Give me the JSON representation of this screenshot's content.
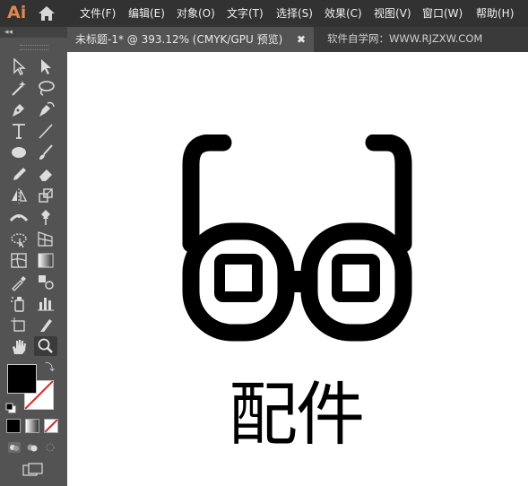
{
  "app": {
    "logo": "Ai"
  },
  "menu": [
    "文件(F)",
    "编辑(E)",
    "对象(O)",
    "文字(T)",
    "选择(S)",
    "效果(C)",
    "视图(V)",
    "窗口(W)",
    "帮助(H)"
  ],
  "document_tab": {
    "title": "未标题-1* @ 393.12% (CMYK/GPU 预览)",
    "close": "✖"
  },
  "watermark": "软件自学网：WWW.RJZXW.COM",
  "toolbar": {
    "collapse": "◂◂",
    "tools": [
      "selection-tool",
      "direct-selection-tool",
      "magic-wand-tool",
      "lasso-tool",
      "pen-tool",
      "curvature-tool",
      "type-tool",
      "line-segment-tool",
      "ellipse-tool",
      "paintbrush-tool",
      "pencil-tool",
      "eraser-tool",
      "reflect-tool",
      "scale-tool",
      "width-tool",
      "puppet-warp-tool",
      "free-transform-tool",
      "perspective-grid-tool",
      "mesh-tool",
      "gradient-tool",
      "eyedropper-tool",
      "blend-tool",
      "symbol-sprayer-tool",
      "column-graph-tool",
      "artboard-tool",
      "slice-tool",
      "hand-tool",
      "zoom-tool"
    ],
    "fill_color": "#000000",
    "stroke_color": "#ffffff"
  },
  "artwork": {
    "icon": "glasses-icon",
    "label": "配件"
  }
}
